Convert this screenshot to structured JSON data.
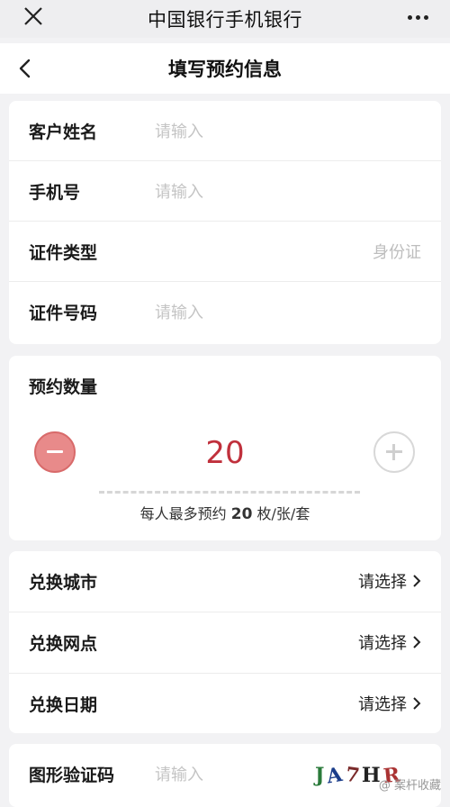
{
  "topbar": {
    "title": "中国银行手机银行"
  },
  "nav": {
    "title": "填写预约信息"
  },
  "personal": {
    "name_label": "客户姓名",
    "name_placeholder": "请输入",
    "phone_label": "手机号",
    "phone_placeholder": "请输入",
    "id_type_label": "证件类型",
    "id_type_value": "身份证",
    "id_number_label": "证件号码",
    "id_number_placeholder": "请输入"
  },
  "quantity": {
    "label": "预约数量",
    "value": "20",
    "note_prefix": "每人最多预约",
    "note_max": "20",
    "note_suffix": "枚/张/套"
  },
  "exchange": {
    "city_label": "兑换城市",
    "city_value": "请选择",
    "branch_label": "兑换网点",
    "branch_value": "请选择",
    "date_label": "兑换日期",
    "date_value": "请选择"
  },
  "captcha": {
    "label": "图形验证码",
    "placeholder": "请输入",
    "chars": [
      "J",
      "A",
      "7",
      "H",
      "R"
    ]
  },
  "watermark": "@ 案杆收藏",
  "colors": {
    "accent": "#c0303c",
    "minus_button": "#e88a8a"
  }
}
